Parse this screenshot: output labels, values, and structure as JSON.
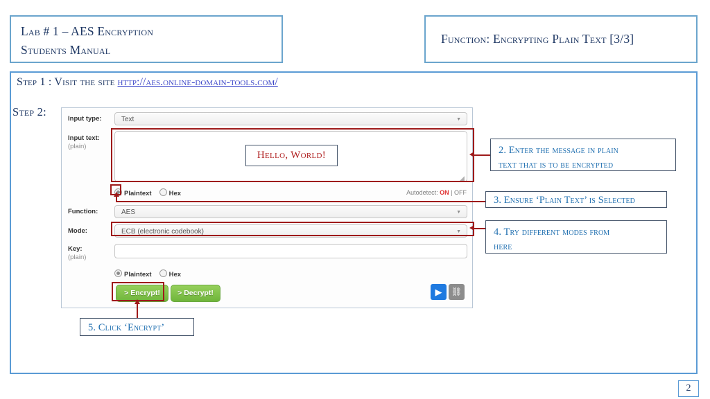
{
  "header": {
    "title_line1": "Lab # 1 – AES Encryption",
    "title_line2": "Students Manual",
    "function_title": "Function: Encrypting Plain Text [3/3]"
  },
  "step1": {
    "text": "Step 1 : Visit the site",
    "link": "http://aes.online-domain-tools.com/"
  },
  "step2": {
    "label": "Step 2:"
  },
  "form": {
    "input_type_label": "Input type:",
    "input_type_value": "Text",
    "input_text_label": "Input text:",
    "input_text_sub": "(plain)",
    "input_text_value": "",
    "radio1_plaintext": "Plaintext",
    "radio1_hex": "Hex",
    "autodetect_prefix": "Autodetect:",
    "autodetect_on": "ON",
    "autodetect_sep": "|",
    "autodetect_off": "OFF",
    "function_label": "Function:",
    "function_value": "AES",
    "mode_label": "Mode:",
    "mode_value": "ECB (electronic codebook)",
    "key_label": "Key:",
    "key_sub": "(plain)",
    "key_value": "",
    "radio2_plaintext": "Plaintext",
    "radio2_hex": "Hex",
    "encrypt_button": "> Encrypt!",
    "decrypt_button": "> Decrypt!",
    "play_icon": "▶",
    "link_icon": "⛓",
    "caret_icon": "▼",
    "resize_icon": "◢"
  },
  "overlay": {
    "hello_world": "Hello, World!"
  },
  "callouts": {
    "c2_line1": "2. Enter the message in plain",
    "c2_line2": "text that is to be encrypted",
    "c3": "3. Ensure ‘Plain Text’ is Selected",
    "c4_line1": "4. Try different modes from",
    "c4_line2": "here",
    "c5": "5. Click ‘Encrypt’"
  },
  "footer": {
    "page_number": "2"
  },
  "colors": {
    "frame_blue": "#5b9bd5",
    "title_navy": "#1f3864",
    "callout_blue": "#1f6fb0",
    "highlight_red": "#9e1a1a",
    "hello_red": "#b02020",
    "button_green": "#6fb53b",
    "link_blue": "#3f49c9"
  }
}
